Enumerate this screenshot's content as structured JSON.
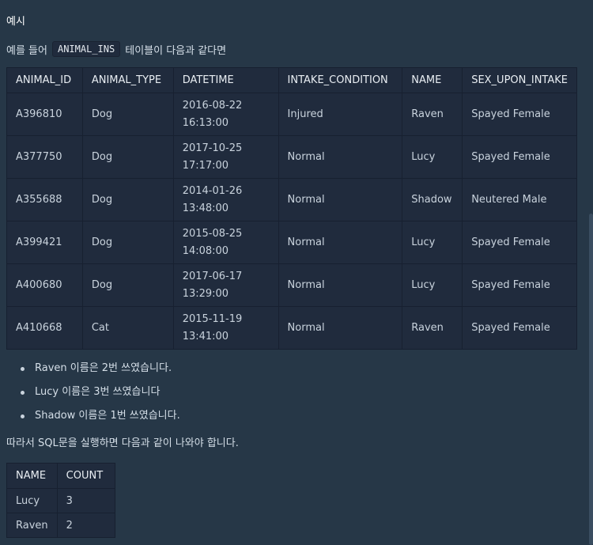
{
  "heading": "예시",
  "intro": {
    "before": "예를 들어",
    "code": "ANIMAL_INS",
    "after": "테이블이 다음과 같다면"
  },
  "animal_table": {
    "headers": [
      "ANIMAL_ID",
      "ANIMAL_TYPE",
      "DATETIME",
      "INTAKE_CONDITION",
      "NAME",
      "SEX_UPON_INTAKE"
    ],
    "rows": [
      {
        "id": "A396810",
        "type": "Dog",
        "date": "2016-08-22",
        "time": "16:13:00",
        "condition": "Injured",
        "name": "Raven",
        "sex": "Spayed Female"
      },
      {
        "id": "A377750",
        "type": "Dog",
        "date": "2017-10-25",
        "time": "17:17:00",
        "condition": "Normal",
        "name": "Lucy",
        "sex": "Spayed Female"
      },
      {
        "id": "A355688",
        "type": "Dog",
        "date": "2014-01-26",
        "time": "13:48:00",
        "condition": "Normal",
        "name": "Shadow",
        "sex": "Neutered Male"
      },
      {
        "id": "A399421",
        "type": "Dog",
        "date": "2015-08-25",
        "time": "14:08:00",
        "condition": "Normal",
        "name": "Lucy",
        "sex": "Spayed Female"
      },
      {
        "id": "A400680",
        "type": "Dog",
        "date": "2017-06-17",
        "time": "13:29:00",
        "condition": "Normal",
        "name": "Lucy",
        "sex": "Spayed Female"
      },
      {
        "id": "A410668",
        "type": "Cat",
        "date": "2015-11-19",
        "time": "13:41:00",
        "condition": "Normal",
        "name": "Raven",
        "sex": "Spayed Female"
      }
    ]
  },
  "bullets": [
    "Raven 이름은 2번 쓰였습니다.",
    "Lucy 이름은 3번 쓰였습니다",
    "Shadow 이름은 1번 쓰였습니다."
  ],
  "conclusion": "따라서 SQL문을 실행하면 다음과 같이 나와야 합니다.",
  "result_table": {
    "headers": [
      "NAME",
      "COUNT"
    ],
    "rows": [
      {
        "name": "Lucy",
        "count": "3"
      },
      {
        "name": "Raven",
        "count": "2"
      }
    ]
  }
}
